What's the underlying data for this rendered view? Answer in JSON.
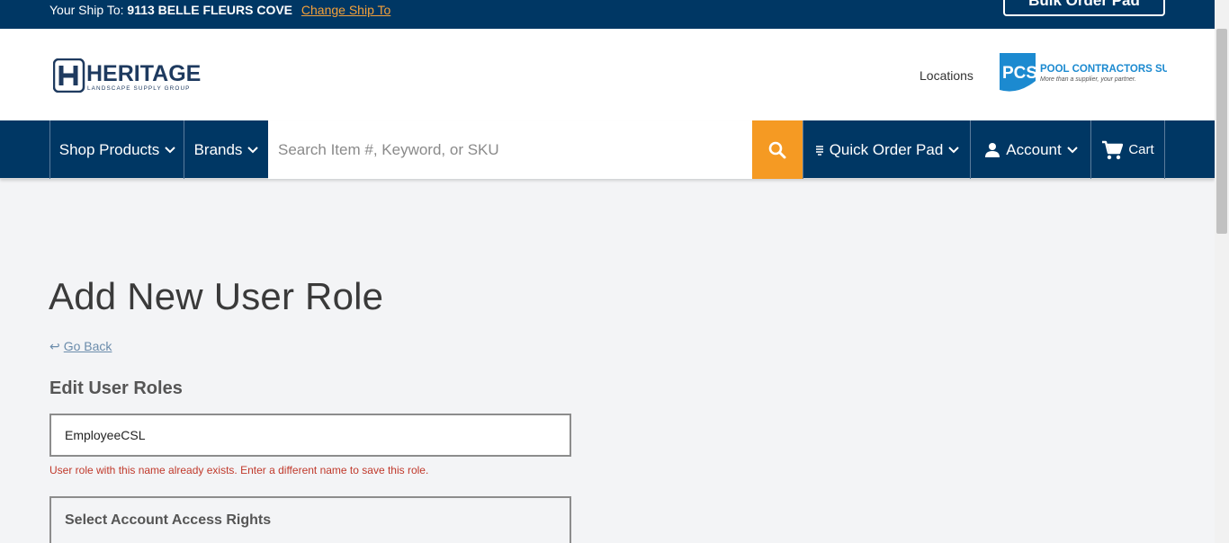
{
  "topbar": {
    "ship_prefix": "Your Ship To:",
    "ship_address": "9113 BELLE FLEURS COVE",
    "change_link": "Change Ship To",
    "bulk_button": "Bulk Order Pad"
  },
  "header": {
    "locations": "Locations",
    "logo_main": "HERITAGE",
    "logo_sub": "LANDSCAPE SUPPLY GROUP",
    "pcs_mark": "PCS",
    "pcs_name": "POOL CONTRACTORS SUPPLY",
    "pcs_tagline": "More than a supplier, your partner."
  },
  "nav": {
    "shop_products": "Shop Products",
    "brands": "Brands",
    "search_placeholder": "Search Item #, Keyword, or SKU",
    "quick_order_pad": "Quick Order Pad",
    "account": "Account",
    "cart": "Cart"
  },
  "main": {
    "title": "Add New User Role",
    "go_back": "Go Back",
    "section_title": "Edit User Roles",
    "role_value": "EmployeeCSL",
    "error_text": "User role with this name already exists. Enter a different name to save this role.",
    "access_title": "Select Account Access Rights"
  },
  "colors": {
    "navy": "#003764",
    "orange": "#f59a23",
    "error": "#c0392b"
  }
}
